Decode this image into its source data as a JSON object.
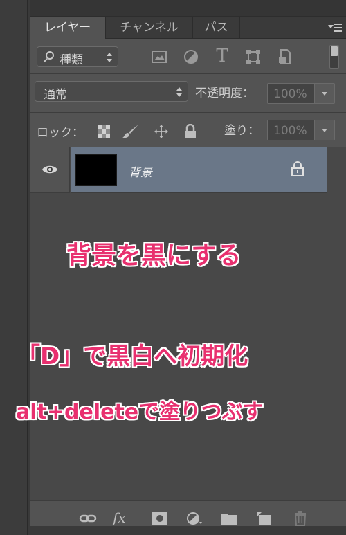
{
  "tabs": [
    {
      "label": "レイヤー",
      "active": true
    },
    {
      "label": "チャンネル",
      "active": false
    },
    {
      "label": "パス",
      "active": false
    }
  ],
  "filter": {
    "kind_label": "種類",
    "icons": [
      "image-filter-icon",
      "adjustment-filter-icon",
      "type-filter-icon",
      "shape-filter-icon",
      "smart-object-filter-icon"
    ],
    "type_glyph": "T"
  },
  "blend": {
    "mode": "通常",
    "opacity_label": "不透明度：",
    "opacity_value": "100%"
  },
  "lock": {
    "label": "ロック：",
    "fill_label": "塗り：",
    "fill_value": "100%"
  },
  "layer": {
    "name": "背景",
    "thumbnail_color": "#000000",
    "selected_color": "#6a7788"
  },
  "annotations": {
    "line1": "背景を黒にする",
    "line2": "「D」で黒白へ初期化",
    "line3": "alt+deleteで塗りつぶす",
    "color": "#e8306f"
  },
  "bottom_icons": [
    "link-icon",
    "fx-icon",
    "mask-icon",
    "adjustment-icon",
    "folder-icon",
    "new-layer-icon",
    "trash-icon"
  ],
  "fx_glyph": "fx"
}
